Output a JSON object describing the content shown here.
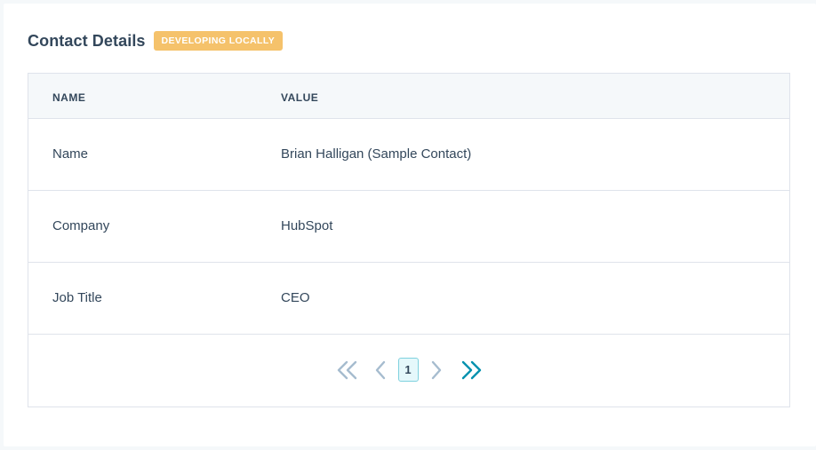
{
  "header": {
    "title": "Contact Details",
    "badge": "DEVELOPING LOCALLY"
  },
  "table": {
    "columns": [
      "NAME",
      "VALUE"
    ],
    "rows": [
      {
        "name": "Name",
        "value": "Brian Halligan (Sample Contact)"
      },
      {
        "name": "Company",
        "value": "HubSpot"
      },
      {
        "name": "Job Title",
        "value": "CEO"
      }
    ]
  },
  "pagination": {
    "current_page": "1",
    "first_icon": "double-chevron-left-icon",
    "prev_icon": "chevron-left-icon",
    "next_icon": "chevron-right-icon",
    "last_icon": "double-chevron-right-icon"
  },
  "colors": {
    "badge_bg": "#f5c26b",
    "header_bg": "#f5f8fa",
    "text": "#33475b",
    "disabled_icon": "#a6bccf",
    "active_icon": "#0091ae",
    "page_border": "#7fd1de"
  }
}
